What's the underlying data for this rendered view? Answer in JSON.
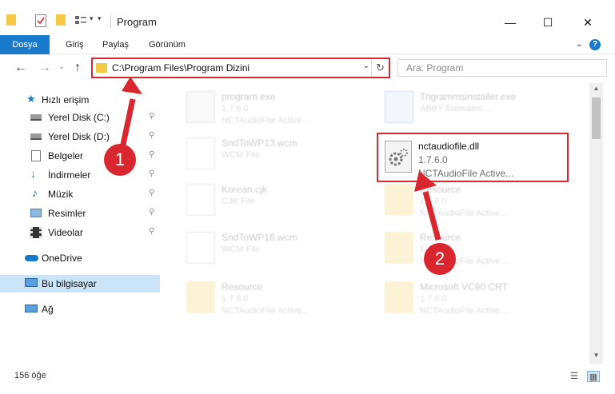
{
  "window": {
    "title": "Program",
    "minimize": "—",
    "maximize": "☐",
    "close": "✕"
  },
  "ribbon": {
    "tabs": [
      "Dosya",
      "Giriş",
      "Paylaş",
      "Görünüm"
    ],
    "help": "?",
    "expand": "⌄"
  },
  "nav": {
    "back": "←",
    "forward": "→",
    "recent": "⌄",
    "up": "↑",
    "address": "C:\\Program Files\\Program Dizini",
    "address_dropdown": "⌄",
    "refresh": "↻",
    "search_placeholder": "Ara: Program"
  },
  "sidebar": {
    "items": [
      {
        "label": "Hızlı erişim",
        "icon": "star-icon",
        "pinned": false
      },
      {
        "label": "Yerel Disk (C:)",
        "icon": "drive-icon",
        "pinned": true
      },
      {
        "label": "Yerel Disk (D:)",
        "icon": "drive-icon",
        "pinned": true
      },
      {
        "label": "Belgeler",
        "icon": "documents-icon",
        "pinned": true
      },
      {
        "label": "İndirmeler",
        "icon": "downloads-icon",
        "pinned": true
      },
      {
        "label": "Müzik",
        "icon": "music-icon",
        "pinned": true
      },
      {
        "label": "Resimler",
        "icon": "pictures-icon",
        "pinned": true
      },
      {
        "label": "Videolar",
        "icon": "videos-icon",
        "pinned": true
      },
      {
        "label": "OneDrive",
        "icon": "cloud-icon",
        "pinned": false
      },
      {
        "label": "Bu bilgisayar",
        "icon": "computer-icon",
        "pinned": false
      },
      {
        "label": "Ağ",
        "icon": "network-icon",
        "pinned": false
      }
    ],
    "pin_glyph": "📌"
  },
  "files": [
    {
      "name": "program.exe",
      "sub": "1.7.6.0",
      "sub2": "NCTAudioFile Active...",
      "icon": "exe-icon"
    },
    {
      "name": "Trigrammsinstaller.exe",
      "sub": "ABBY fixomatoc ...",
      "sub2": "",
      "icon": "installer-icon"
    },
    {
      "name": "SndToWP13.wcm",
      "sub": "WCM File",
      "sub2": "",
      "icon": "file-icon"
    },
    {
      "name": "nctaudiofile.dll",
      "sub": "1.7.6.0",
      "sub2": "NCTAudioFile Active...",
      "icon": "dll-icon"
    },
    {
      "name": "Korean.cjk",
      "sub": "CJK File",
      "sub2": "",
      "icon": "file-icon"
    },
    {
      "name": "Resource",
      "sub": "1.7.6.0",
      "sub2": "NCTAudioFile Active...",
      "icon": "folder-file-icon"
    },
    {
      "name": "SndToWP16.wcm",
      "sub": "WCM File",
      "sub2": "",
      "icon": "file-icon"
    },
    {
      "name": "Resource",
      "sub": "1.7.6.0",
      "sub2": "NCTAudioFile Active...",
      "icon": "folder-file-icon"
    },
    {
      "name": "Resource",
      "sub": "1.7.6.0",
      "sub2": "NCTAudioFile Active...",
      "icon": "folder-file-icon"
    },
    {
      "name": "Microsoft VC90 CRT",
      "sub": "1.7.6.0",
      "sub2": "NCTAudioFile Active...",
      "icon": "folder-file-icon"
    }
  ],
  "status": {
    "count": "156 öğe"
  },
  "annotations": {
    "step1": "1",
    "step2": "2",
    "color": "#d9262f"
  },
  "colors": {
    "accent": "#1979ca",
    "highlight_border": "#d9262f",
    "selected_bg": "#cce4f7"
  }
}
